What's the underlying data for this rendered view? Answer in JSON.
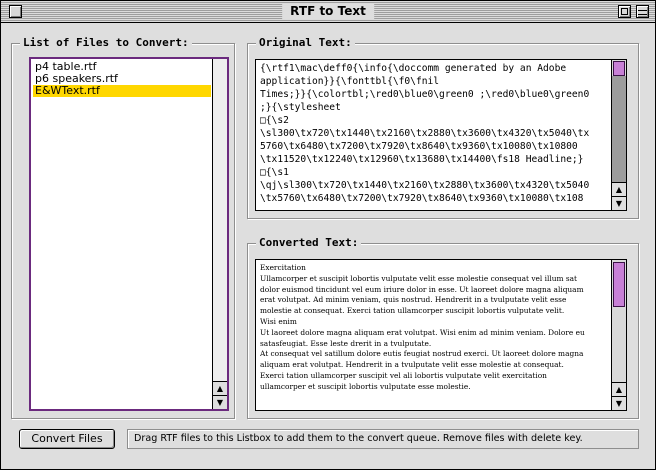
{
  "window": {
    "title": "RTF to Text"
  },
  "files": {
    "label": "List of Files to Convert:",
    "items": [
      "p4 table.rtf",
      "p6 speakers.rtf",
      "E&WText.rtf"
    ],
    "selected_index": 2
  },
  "original": {
    "label": "Original Text:",
    "lines": [
      "{\\rtf1\\mac\\deff0{\\info{\\doccomm generated by an Adobe",
      "application}}{\\fonttbl{\\f0\\fnil",
      "Times;}}{\\colortbl;\\red0\\blue0\\green0 ;\\red0\\blue0\\green0",
      ";}{\\stylesheet",
      "□{\\s2",
      "\\sl300\\tx720\\tx1440\\tx2160\\tx2880\\tx3600\\tx4320\\tx5040\\tx",
      "5760\\tx6480\\tx7200\\tx7920\\tx8640\\tx9360\\tx10080\\tx10800",
      "\\tx11520\\tx12240\\tx12960\\tx13680\\tx14400\\fs18 Headline;}",
      "□{\\s1",
      "\\qj\\sl300\\tx720\\tx1440\\tx2160\\tx2880\\tx3600\\tx4320\\tx5040",
      "\\tx5760\\tx6480\\tx7200\\tx7920\\tx8640\\tx9360\\tx10080\\tx108"
    ]
  },
  "converted": {
    "label": "Converted Text:",
    "lines": [
      "Exercitation",
      "Ullamcorper et suscipit lobortis vulputate velit esse molestie consequat vel illum sat",
      "dolor euismod tincidunt vel eum iriure dolor in esse. Ut laoreet dolore magna aliquam",
      "erat volutpat. Ad minim veniam, quis nostrud. Hendrerit in a tvulputate velit esse",
      "molestie at consequat. Exerci tation ullamcorper suscipit lobortis vulputate velit.",
      "Wisi enim",
      "Ut laoreet dolore magna aliquam erat volutpat. Wisi enim ad minim veniam. Dolore eu",
      "satasfeugiat. Esse leste drerit in a tvulputate.",
      "At consequat vel satillum dolore eutis feugiat nostrud exerci. Ut laoreet dolore magna",
      "aliquam erat volutpat. Hendrerit in a tvulputate velit esse molestie at consequat.",
      "Exerci tation ullamcorper suscipit vel ali lobortis vulputate velit exercitation",
      "ullamcorper et suscipit lobortis vulputate esse molestie."
    ]
  },
  "actions": {
    "convert_label": "Convert Files"
  },
  "status": {
    "text": "Drag RTF files to this Listbox to add them to the convert queue. Remove files with delete key."
  },
  "icons": {
    "close": "close-box-icon",
    "zoom": "zoom-box-icon",
    "collapse": "collapse-box-icon",
    "arrow_up": "▲",
    "arrow_down": "▼"
  },
  "colors": {
    "list_selection": "#ffd700",
    "scroll_thumb": "#c880d6",
    "focus_border": "#6b2a7e"
  }
}
